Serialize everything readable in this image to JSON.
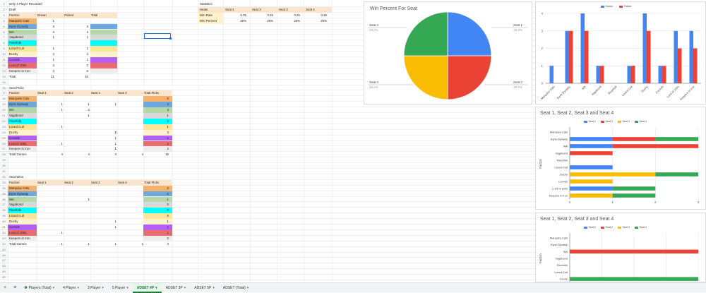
{
  "sheet": {
    "row_numbers": [
      "1",
      "2",
      "3",
      "4",
      "5",
      "6",
      "7",
      "8",
      "9",
      "10",
      "11",
      "12",
      "13",
      "14",
      "15",
      "16",
      "17",
      "18",
      "19",
      "20",
      "21",
      "22",
      "23",
      "24",
      "25",
      "26",
      "27",
      "28",
      "29",
      "30",
      "31",
      "32",
      "33",
      "34",
      "35",
      "36",
      "37",
      "38",
      "39",
      "40",
      "41",
      "42",
      "43",
      "44",
      "45",
      "46",
      "47",
      "48",
      "49",
      "50"
    ],
    "title": "Only 4 Player Recorded",
    "draft": {
      "label": "Draft",
      "headers": [
        "Faction",
        "Drawn",
        "Picked",
        "Total"
      ],
      "rows": [
        {
          "faction": "Marquise Cats",
          "drawn": "1",
          "picked": "",
          "total": "",
          "color": "#f6b26b"
        },
        {
          "faction": "Eyrie Dynasty",
          "drawn": "3",
          "picked": "3",
          "total": "",
          "color": "#6fa8dc"
        },
        {
          "faction": "WA",
          "drawn": "4",
          "picked": "3",
          "total": "",
          "color": "#b6d7a8"
        },
        {
          "faction": "Vagabond",
          "drawn": "1",
          "picked": "1",
          "total": "",
          "color": "#d9d9d9"
        },
        {
          "faction": "Riverfolk",
          "drawn": "",
          "picked": "",
          "total": "",
          "color": "#00ffff"
        },
        {
          "faction": "Lizard Cult",
          "drawn": "1",
          "picked": "1",
          "total": "",
          "color": "#ffe599"
        },
        {
          "faction": "Duchy",
          "drawn": "4",
          "picked": "3",
          "total": "",
          "color": "#fff2cc"
        },
        {
          "faction": "Corvids",
          "drawn": "1",
          "picked": "1",
          "total": "",
          "color": "#b45ff5"
        },
        {
          "faction": "Lord of 100s",
          "drawn": "3",
          "picked": "2",
          "total": "",
          "color": "#ea6c6c"
        },
        {
          "faction": "Keepers in Iron",
          "drawn": "3",
          "picked": "2",
          "total": "",
          "color": "#eeeeee"
        }
      ],
      "total_label": "Total",
      "total_drawn": "21",
      "total_picked": "16"
    },
    "seat_picks": {
      "label": "Seat Picks",
      "headers": [
        "Faction",
        "Seat 1",
        "Seat 2",
        "Seat 3",
        "Seat 4",
        "Total Picks"
      ],
      "rows": [
        {
          "faction": "Marquise Cats",
          "s1": "",
          "s2": "",
          "s3": "",
          "s4": "",
          "total": "0"
        },
        {
          "faction": "Eyrie Dynasty",
          "s1": "1",
          "s2": "1",
          "s3": "",
          "s4": "1",
          "total": "3"
        },
        {
          "faction": "WA",
          "s1": "1",
          "s2": "2",
          "s3": "",
          "s4": "",
          "total": "3"
        },
        {
          "faction": "Vagabond",
          "s1": "",
          "s2": "1",
          "s3": "",
          "s4": "",
          "total": "1"
        },
        {
          "faction": "Riverfolk",
          "s1": "",
          "s2": "",
          "s3": "",
          "s4": "",
          "total": "0"
        },
        {
          "faction": "Lizard Cult",
          "s1": "1",
          "s2": "",
          "s3": "",
          "s4": "",
          "total": "1"
        },
        {
          "faction": "Duchy",
          "s1": "",
          "s2": "",
          "s3": "2",
          "s4": "1",
          "total": "3"
        },
        {
          "faction": "Corvids",
          "s1": "",
          "s2": "",
          "s3": "1",
          "s4": "",
          "total": "1"
        },
        {
          "faction": "Lord of 100s",
          "s1": "1",
          "s2": "",
          "s3": "",
          "s4": "1",
          "total": "2"
        },
        {
          "faction": "Keepers in Iron",
          "s1": "",
          "s2": "",
          "s3": "1",
          "s4": "1",
          "total": "2"
        }
      ],
      "total_label": "Total Games",
      "totals": [
        "4",
        "4",
        "4",
        "4",
        "16"
      ]
    },
    "seat_wins": {
      "label": "Seat Wins",
      "headers": [
        "Faction",
        "Seat 1",
        "Seat 2",
        "Seat 3",
        "Seat 4",
        "Total Picks"
      ],
      "rows": [
        {
          "faction": "Marquise Cats",
          "s1": "",
          "s2": "",
          "s3": "",
          "s4": "",
          "total": "0"
        },
        {
          "faction": "Eyrie Dynasty",
          "s1": "",
          "s2": "",
          "s3": "",
          "s4": "",
          "total": "0"
        },
        {
          "faction": "WA",
          "s1": "",
          "s2": "1",
          "s3": "",
          "s4": "",
          "total": "1"
        },
        {
          "faction": "Vagabond",
          "s1": "",
          "s2": "",
          "s3": "",
          "s4": "",
          "total": "0"
        },
        {
          "faction": "Riverfolk",
          "s1": "",
          "s2": "",
          "s3": "",
          "s4": "",
          "total": "0"
        },
        {
          "faction": "Lizard Cult",
          "s1": "",
          "s2": "",
          "s3": "",
          "s4": "",
          "total": "0"
        },
        {
          "faction": "Duchy",
          "s1": "",
          "s2": "",
          "s3": "",
          "s4": "1",
          "total": "1"
        },
        {
          "faction": "Corvids",
          "s1": "",
          "s2": "",
          "s3": "1",
          "s4": "",
          "total": "1"
        },
        {
          "faction": "Lord of 100s",
          "s1": "1",
          "s2": "",
          "s3": "",
          "s4": "",
          "total": "1"
        },
        {
          "faction": "Keepers in Iron",
          "s1": "",
          "s2": "",
          "s3": "",
          "s4": "",
          "total": "0"
        }
      ],
      "total_label": "Total Games",
      "totals": [
        "1",
        "1",
        "1",
        "1",
        "4"
      ]
    },
    "statistics": {
      "label": "Statistics",
      "headers": [
        "Seats",
        "Seat 1",
        "Seat 2",
        "Seat 3",
        "Seat 4"
      ],
      "rows": [
        {
          "label": "Win Rate",
          "values": [
            "0.25",
            "0.25",
            "0.25",
            "0.25"
          ]
        },
        {
          "label": "Win Percent",
          "values": [
            "25%",
            "25%",
            "25%",
            "25%"
          ]
        }
      ]
    }
  },
  "chart_data": [
    {
      "type": "pie",
      "title": "Win Percent For Seat",
      "slices": [
        {
          "label": "Seat 1",
          "value": 25,
          "pct_label": "25.0%",
          "color": "#4285f4"
        },
        {
          "label": "Seat 2",
          "value": 25,
          "pct_label": "25.0%",
          "color": "#ea4335"
        },
        {
          "label": "Seat 3",
          "value": 25,
          "pct_label": "25.0%",
          "color": "#fbbc04"
        },
        {
          "label": "Seat 4",
          "value": 25,
          "pct_label": "25.0%",
          "color": "#34a853"
        }
      ]
    },
    {
      "type": "bar",
      "title": "",
      "categories": [
        "Marquise Cats",
        "Eyrie Dynasty",
        "WA",
        "Vagabond",
        "Riverfolk",
        "Lizard Cult",
        "Duchy",
        "Corvids",
        "Lord of 100s",
        "Keepers in Iron"
      ],
      "series": [
        {
          "name": "Drawn",
          "color": "#4285f4",
          "values": [
            1,
            3,
            4,
            1,
            0,
            1,
            4,
            1,
            3,
            3
          ]
        },
        {
          "name": "Picked",
          "color": "#ea4335",
          "values": [
            0,
            3,
            3,
            1,
            0,
            1,
            3,
            1,
            2,
            2
          ]
        }
      ],
      "yticks": [
        "0",
        "1",
        "2",
        "3",
        "4"
      ],
      "ylim": [
        0,
        4
      ],
      "legend": "top"
    },
    {
      "type": "bar",
      "orientation": "horizontal-stacked",
      "title": "Seat 1, Seat 2, Seat 3 and Seat 4",
      "ylabel": "Faction",
      "categories": [
        "Marquise Cats",
        "Eyrie Dynasty",
        "WA",
        "Vagabond",
        "Riverfolk",
        "Lizard Cult",
        "Duchy",
        "Corvids",
        "Lord of 100s",
        "Keepers in Iron"
      ],
      "series": [
        {
          "name": "Seat 1",
          "color": "#4285f4",
          "values": [
            0,
            1,
            1,
            0,
            0,
            1,
            0,
            0,
            1,
            0
          ]
        },
        {
          "name": "Seat 2",
          "color": "#ea4335",
          "values": [
            0,
            1,
            2,
            1,
            0,
            0,
            0,
            0,
            0,
            0
          ]
        },
        {
          "name": "Seat 3",
          "color": "#fbbc04",
          "values": [
            0,
            0,
            0,
            0,
            0,
            0,
            2,
            1,
            0,
            1
          ]
        },
        {
          "name": "Seat 4",
          "color": "#34a853",
          "values": [
            0,
            1,
            0,
            0,
            0,
            0,
            1,
            0,
            1,
            1
          ]
        }
      ],
      "xticks": [
        "0",
        "1",
        "2",
        "3"
      ],
      "xlim": [
        0,
        3
      ],
      "legend": "top"
    },
    {
      "type": "bar",
      "orientation": "horizontal-stacked",
      "title": "Seat 1, Seat 2, Seat 3 and Seat 4",
      "ylabel": "Faction",
      "categories": [
        "Marquise Cats",
        "Eyrie Dynasty",
        "WA",
        "Vagabond",
        "Riverfolk",
        "Lizard Cult",
        "Duchy"
      ],
      "series": [
        {
          "name": "Seat 1",
          "color": "#4285f4",
          "values": [
            0,
            0,
            0,
            0,
            0,
            0,
            0
          ]
        },
        {
          "name": "Seat 2",
          "color": "#ea4335",
          "values": [
            0,
            0,
            1,
            0,
            0,
            0,
            0
          ]
        },
        {
          "name": "Seat 3",
          "color": "#fbbc04",
          "values": [
            0,
            0,
            0,
            0,
            0,
            0,
            0
          ]
        },
        {
          "name": "Seat 4",
          "color": "#34a853",
          "values": [
            0,
            0,
            0,
            0,
            0,
            0,
            1
          ]
        }
      ],
      "xlim": [
        0,
        1
      ],
      "legend": "top"
    }
  ],
  "tabs": {
    "add_icon": "+",
    "menu_icon": "≡",
    "items": [
      {
        "label": "Players (Total)",
        "icon": "❶",
        "active": false
      },
      {
        "label": "4 Player",
        "active": false
      },
      {
        "label": "3 Player",
        "active": false
      },
      {
        "label": "5 Player",
        "active": false
      },
      {
        "label": "ADSET 4P",
        "active": true
      },
      {
        "label": "ADSET 3P",
        "active": false
      },
      {
        "label": "ADSET 5P",
        "active": false
      },
      {
        "label": "ADSET (Total)",
        "active": false
      }
    ],
    "dropdown_icon": "▾"
  }
}
